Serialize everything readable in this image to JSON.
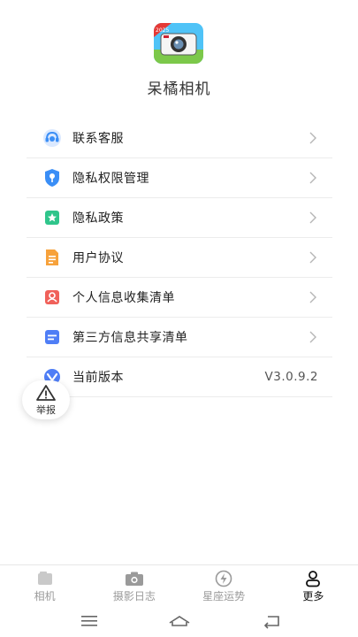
{
  "app": {
    "name": "呆橘相机",
    "icon": "camera-app-icon",
    "badge": "2025"
  },
  "menu": {
    "items": [
      {
        "label": "联系客服",
        "icon": "customer-service-icon",
        "color": "#3a8ef6"
      },
      {
        "label": "隐私权限管理",
        "icon": "shield-key-icon",
        "color": "#3a8ef6"
      },
      {
        "label": "隐私政策",
        "icon": "bookmark-star-icon",
        "color": "#2fc58b"
      },
      {
        "label": "用户协议",
        "icon": "document-icon",
        "color": "#f7a23b"
      },
      {
        "label": "个人信息收集清单",
        "icon": "user-card-icon",
        "color": "#f0615a"
      },
      {
        "label": "第三方信息共享清单",
        "icon": "list-card-icon",
        "color": "#4f7ef6"
      },
      {
        "label": "当前版本",
        "icon": "version-v-icon",
        "color": "#4f7ef6"
      }
    ],
    "version_value": "V3.0.9.2"
  },
  "report": {
    "label": "举报",
    "icon": "warning-triangle-icon"
  },
  "tabbar": {
    "tabs": [
      {
        "label": "相机",
        "icon": "photo-icon",
        "active": false
      },
      {
        "label": "摄影日志",
        "icon": "camera-icon",
        "active": false
      },
      {
        "label": "星座运势",
        "icon": "lightning-circle-icon",
        "active": false
      },
      {
        "label": "更多",
        "icon": "person-icon",
        "active": true
      }
    ]
  },
  "system_nav": {
    "buttons": [
      "menu-icon",
      "home-icon",
      "back-icon"
    ]
  },
  "colors": {
    "accent_blue": "#3a8ef6",
    "tab_inactive": "#9a9a9a",
    "tab_active": "#111111",
    "divider": "#ececec"
  }
}
